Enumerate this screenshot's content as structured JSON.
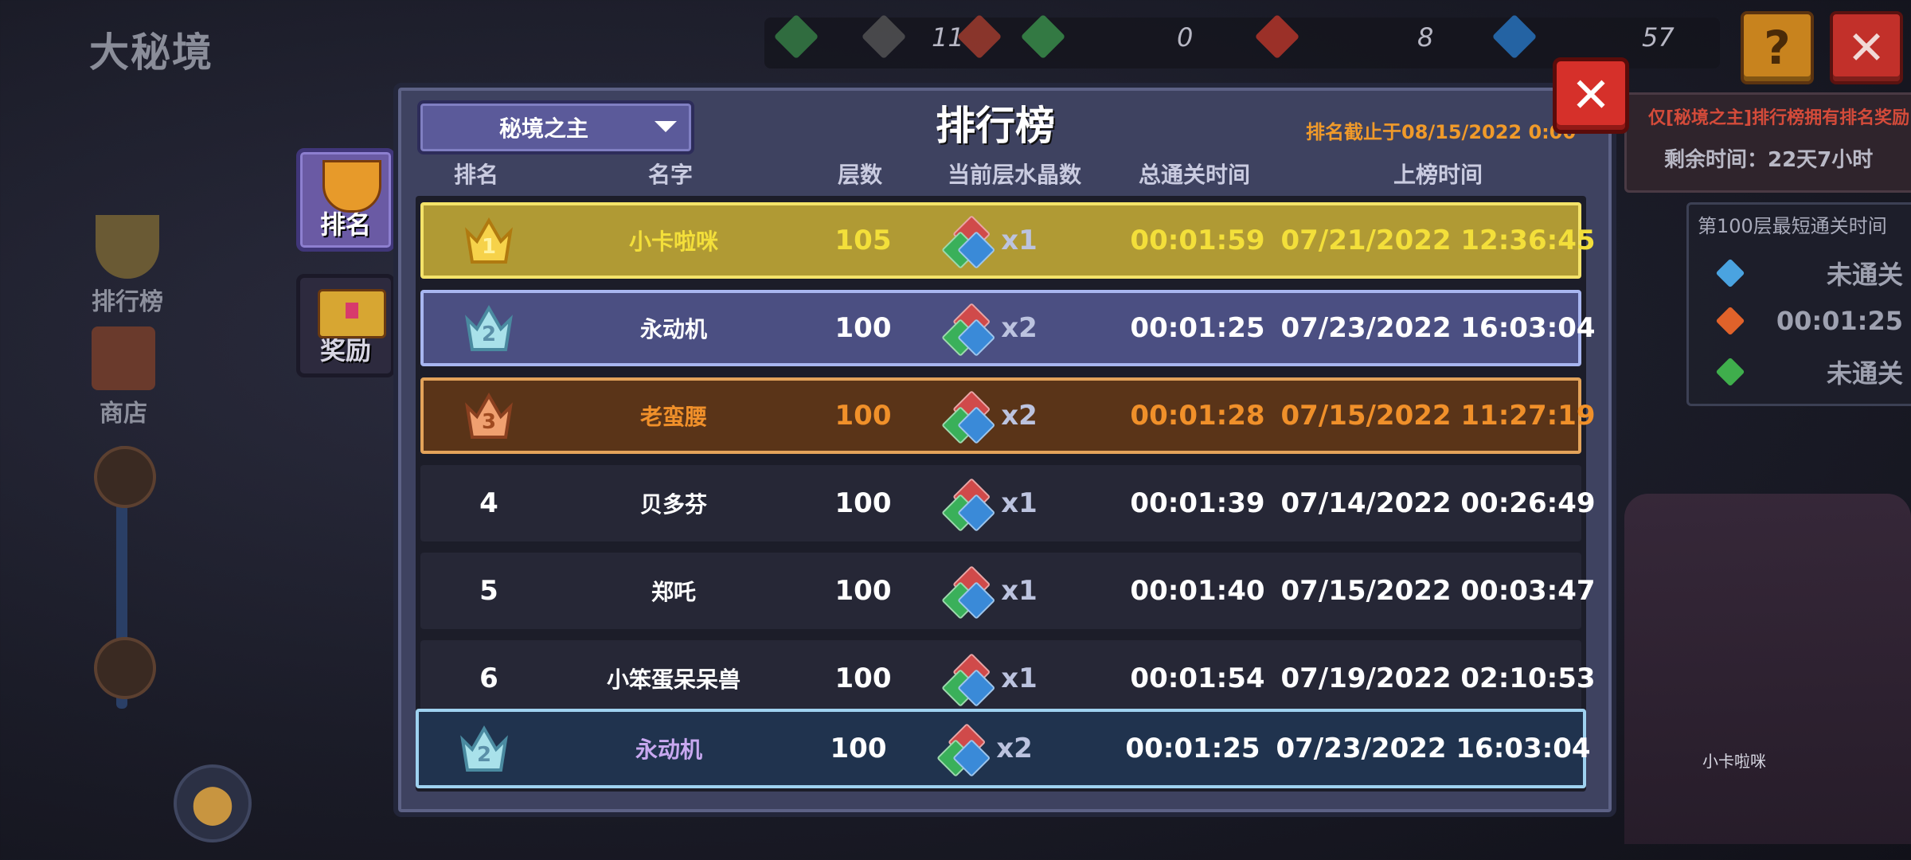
{
  "background": {
    "title": "大秘境",
    "resources": [
      "11",
      "0",
      "8",
      "57"
    ],
    "help_label": "?",
    "close_label": "✕",
    "side_items": [
      "排行榜",
      "商店"
    ],
    "notice": "仅[秘境之主]排行榜拥有排名奖励",
    "remaining": "剩余时间：22天7小时",
    "best_panel": {
      "title": "第100层最短通关时间",
      "rows": [
        {
          "color": "#4aa3e0",
          "value": "未通关"
        },
        {
          "color": "#e0622a",
          "value": "00:01:25"
        },
        {
          "color": "#3fae4c",
          "value": "未通关"
        }
      ]
    },
    "throne_name": "小卡啦咪"
  },
  "tabs": [
    {
      "label": "排名",
      "icon": "trophy-icon",
      "active": true
    },
    {
      "label": "奖励",
      "icon": "treasure-chest-icon",
      "active": false
    }
  ],
  "leaderboard": {
    "dropdown_value": "秘境之主",
    "title": "排行榜",
    "deadline": "排名截止于08/15/2022 0:00",
    "close_label": "✕",
    "headers": [
      "排名",
      "名字",
      "层数",
      "当前层水晶数",
      "总通关时间",
      "上榜时间"
    ],
    "rows": [
      {
        "rank": "1",
        "name": "小卡啦咪",
        "floor": "105",
        "crystals": "x1",
        "time": "00:01:59",
        "date": "07/21/2022 12:36:45",
        "style": "gold"
      },
      {
        "rank": "2",
        "name": "永动机",
        "floor": "100",
        "crystals": "x2",
        "time": "00:01:25",
        "date": "07/23/2022 16:03:04",
        "style": "silver"
      },
      {
        "rank": "3",
        "name": "老蛮腰",
        "floor": "100",
        "crystals": "x2",
        "time": "00:01:28",
        "date": "07/15/2022 11:27:19",
        "style": "bronze"
      },
      {
        "rank": "4",
        "name": "贝多芬",
        "floor": "100",
        "crystals": "x1",
        "time": "00:01:39",
        "date": "07/14/2022 00:26:49",
        "style": "plain"
      },
      {
        "rank": "5",
        "name": "郑吒",
        "floor": "100",
        "crystals": "x1",
        "time": "00:01:40",
        "date": "07/15/2022 00:03:47",
        "style": "plain"
      },
      {
        "rank": "6",
        "name": "小笨蛋呆呆兽",
        "floor": "100",
        "crystals": "x1",
        "time": "00:01:54",
        "date": "07/19/2022 02:10:53",
        "style": "plain"
      }
    ],
    "self_row": {
      "rank": "2",
      "name": "永动机",
      "floor": "100",
      "crystals": "x2",
      "time": "00:01:25",
      "date": "07/23/2022 16:03:04",
      "style": "self"
    }
  },
  "colors": {
    "gold": "#f3df3a",
    "bronze_text": "#f0902a",
    "self_name": "#c8a8f0"
  }
}
